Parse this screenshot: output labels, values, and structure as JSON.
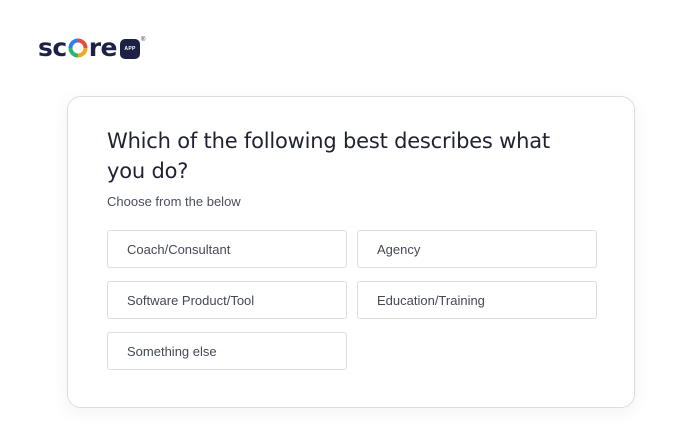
{
  "logo": {
    "text_prefix": "sc",
    "text_suffix": "re",
    "badge": "APP",
    "reg": "®",
    "colors": [
      "#e84b3c",
      "#f5a623",
      "#2db36b",
      "#2f80ed"
    ]
  },
  "quiz": {
    "question": "Which of the following best describes what you do?",
    "subtitle": "Choose from the below",
    "options": [
      {
        "label": "Coach/Consultant"
      },
      {
        "label": "Agency"
      },
      {
        "label": "Software Product/Tool"
      },
      {
        "label": "Education/Training"
      },
      {
        "label": "Something else"
      }
    ]
  }
}
